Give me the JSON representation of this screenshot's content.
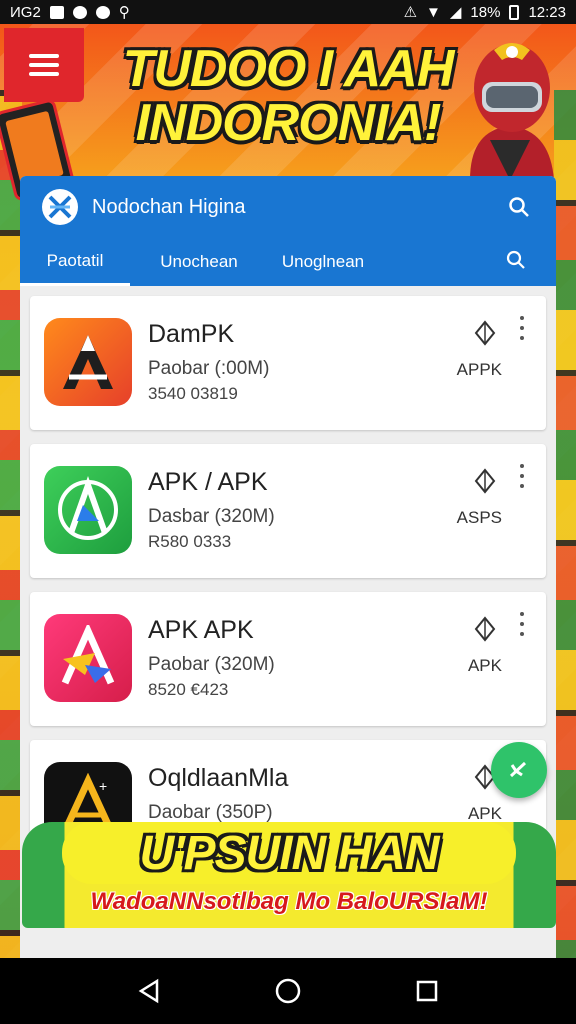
{
  "status_bar": {
    "left_text": "ИG2",
    "battery_text": "18%",
    "time": "12:23"
  },
  "banner": {
    "title_line1": "TUDOO I AAH",
    "title_line2": "INDORONIA!"
  },
  "app": {
    "title": "Nodochan Higina",
    "tabs": [
      "Paotatil",
      "Unochean",
      "Unoglnean"
    ],
    "active_tab": 0,
    "accent_color": "#1976d2",
    "fab_color": "#2fc36a"
  },
  "apps": [
    {
      "name": "DamPK",
      "subtitle": "Paobar (:00M)",
      "meta": "3540 03819",
      "type": "APPK",
      "icon": "a-letter-orange"
    },
    {
      "name": "APK / APK",
      "subtitle": "Dasbar (320M)",
      "meta": "R580 0333",
      "type": "ASPS",
      "icon": "a-letter-green"
    },
    {
      "name": "APK APK",
      "subtitle": "Paobar (320M)",
      "meta": "8520 €423",
      "type": "APK",
      "icon": "a-letter-pink"
    },
    {
      "name": "OqldlaanMla",
      "subtitle": "Daobar (350P)",
      "meta": "",
      "type": "APK",
      "icon": "a-letter-black"
    }
  ],
  "promo": {
    "title": "U'PSUIN HAN",
    "subtitle": "WadoaNNsotlbag Mo BaloURSIaM!"
  }
}
